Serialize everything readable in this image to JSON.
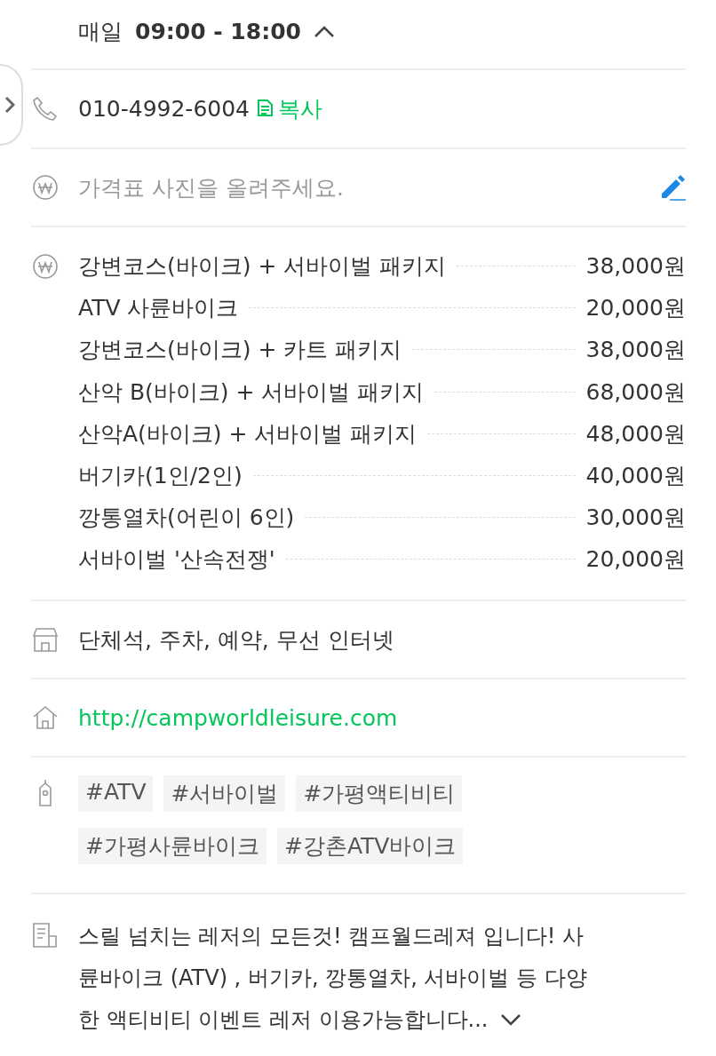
{
  "hours": {
    "days": "매일",
    "time": "09:00 - 18:00",
    "expanded": true
  },
  "phone": {
    "number": "010-4992-6004",
    "copy_label": "복사"
  },
  "price_photo": {
    "prompt": "가격표 사진을 올려주세요."
  },
  "prices": [
    {
      "name": "강변코스(바이크) + 서바이벌 패키지",
      "price": "38,000원"
    },
    {
      "name": "ATV 사륜바이크",
      "price": "20,000원"
    },
    {
      "name": "강변코스(바이크) + 카트 패키지",
      "price": "38,000원"
    },
    {
      "name": "산악 B(바이크) + 서바이벌 패키지",
      "price": "68,000원"
    },
    {
      "name": "산악A(바이크) + 서바이벌 패키지",
      "price": "48,000원"
    },
    {
      "name": "버기카(1인/2인)",
      "price": "40,000원"
    },
    {
      "name": "깡통열차(어린이 6인)",
      "price": "30,000원"
    },
    {
      "name": "서바이벌 '산속전쟁'",
      "price": "20,000원"
    }
  ],
  "facilities": "단체석, 주차, 예약, 무선 인터넷",
  "website": "http://campworldleisure.com",
  "tags": [
    "#ATV",
    "#서바이벌",
    "#가평액티비티",
    "#가평사륜바이크",
    "#강촌ATV바이크"
  ],
  "description": {
    "lines": [
      "스릴 넘치는 레저의 모든것! 캠프월드레져 입니다! 사",
      "륜바이크 (ATV) , 버기카, 깡통열차, 서바이벌 등 다양",
      "한 액티비티 이벤트 레저 이용가능합니다..."
    ],
    "expanded": false
  }
}
